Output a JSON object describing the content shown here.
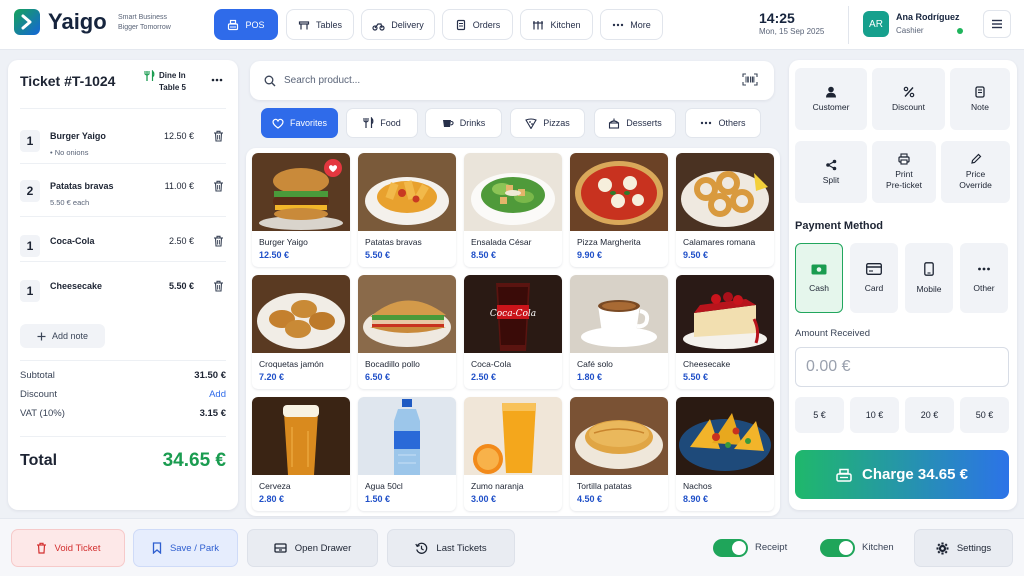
{
  "header": {
    "brand": "Yaigo",
    "tagline_line1": "Smart Business",
    "tagline_line2": "Bigger Tomorrow",
    "nav": [
      {
        "label": "POS",
        "icon": "cash-register-icon",
        "active": true
      },
      {
        "label": "Tables",
        "icon": "table-icon"
      },
      {
        "label": "Delivery",
        "icon": "scooter-icon"
      },
      {
        "label": "Orders",
        "icon": "receipt-icon"
      },
      {
        "label": "Kitchen",
        "icon": "kitchen-icon"
      },
      {
        "label": "More",
        "icon": "more-dots-icon"
      }
    ],
    "time": "14:25",
    "date": "Mon, 15 Sep 2025",
    "user": {
      "initials": "AR",
      "name": "Ana Rodríguez",
      "role": "Cashier",
      "status_color": "#1fb45c"
    }
  },
  "ticket": {
    "title": "Ticket #T-1024",
    "dine_in_line1": "Dine In",
    "dine_in_line2": "Table 5",
    "items": [
      {
        "qty": "1",
        "name": "Burger Yaigo",
        "note": "• No onions",
        "price": "12.50 €"
      },
      {
        "qty": "2",
        "name": "Patatas bravas",
        "note": "5.50 € each",
        "price": "11.00 €"
      },
      {
        "qty": "1",
        "name": "Coca-Cola",
        "note": "",
        "price": "2.50 €"
      },
      {
        "qty": "1",
        "name": "Cheesecake",
        "note": "",
        "price": "5.50 €"
      }
    ],
    "add_note": "Add note",
    "subtotal_label": "Subtotal",
    "subtotal": "31.50 €",
    "discount_label": "Discount",
    "discount_action": "Add",
    "vat_label": "VAT (10%)",
    "vat": "3.15 €",
    "total_label": "Total",
    "total": "34.65 €"
  },
  "search": {
    "placeholder": "Search product..."
  },
  "categories": [
    {
      "label": "Favorites",
      "active": true
    },
    {
      "label": "Food"
    },
    {
      "label": "Drinks"
    },
    {
      "label": "Pizzas"
    },
    {
      "label": "Desserts"
    },
    {
      "label": "Others"
    }
  ],
  "products": [
    {
      "name": "Burger Yaigo",
      "price": "12.50 €",
      "favorite": true,
      "image": "burger"
    },
    {
      "name": "Patatas bravas",
      "price": "5.50 €",
      "image": "fries"
    },
    {
      "name": "Ensalada César",
      "price": "8.50 €",
      "image": "salad"
    },
    {
      "name": "Pizza Margherita",
      "price": "9.90 €",
      "image": "pizza"
    },
    {
      "name": "Calamares romana",
      "price": "9.50 €",
      "image": "calamari"
    },
    {
      "name": "Croquetas jamón",
      "price": "7.20 €",
      "image": "croquettes"
    },
    {
      "name": "Bocadillo pollo",
      "price": "6.50 €",
      "image": "sandwich"
    },
    {
      "name": "Coca-Cola",
      "price": "2.50 €",
      "image": "cola"
    },
    {
      "name": "Café solo",
      "price": "1.80 €",
      "image": "coffee"
    },
    {
      "name": "Cheesecake",
      "price": "5.50 €",
      "image": "cheesecake"
    },
    {
      "name": "Cerveza",
      "price": "2.80 €",
      "image": "beer"
    },
    {
      "name": "Agua 50cl",
      "price": "1.50 €",
      "image": "water"
    },
    {
      "name": "Zumo naranja",
      "price": "3.00 €",
      "image": "juice"
    },
    {
      "name": "Tortilla patatas",
      "price": "4.50 €",
      "image": "tortilla"
    },
    {
      "name": "Nachos",
      "price": "8.90 €",
      "image": "nachos"
    }
  ],
  "actions": [
    {
      "label": "Customer",
      "icon": "user-icon"
    },
    {
      "label": "Discount",
      "icon": "percent-icon"
    },
    {
      "label": "Note",
      "icon": "note-icon"
    },
    {
      "label": "Split",
      "icon": "split-icon"
    },
    {
      "label": "Print Pre-ticket",
      "line1": "Print",
      "line2": "Pre-ticket",
      "icon": "printer-icon"
    },
    {
      "label": "Price Override",
      "line1": "Price",
      "line2": "Override",
      "icon": "pencil-icon"
    }
  ],
  "payment": {
    "title": "Payment Method",
    "methods": [
      {
        "label": "Cash",
        "active": true
      },
      {
        "label": "Card"
      },
      {
        "label": "Mobile"
      },
      {
        "label": "Other"
      }
    ],
    "amount_label": "Amount Received",
    "amount_placeholder": "0.00 €",
    "quick": [
      "5 €",
      "10 €",
      "20 €",
      "50 €"
    ],
    "charge": "Charge 34.65 €"
  },
  "footer": {
    "void": "Void Ticket",
    "save": "Save / Park",
    "drawer": "Open Drawer",
    "last": "Last Tickets",
    "receipt": "Receipt",
    "receipt_on": true,
    "kitchen": "Kitchen",
    "kitchen_on": true,
    "settings": "Settings"
  },
  "colors": {
    "accent": "#2f6bea",
    "success": "#1a9c50",
    "danger": "#e4373f"
  }
}
